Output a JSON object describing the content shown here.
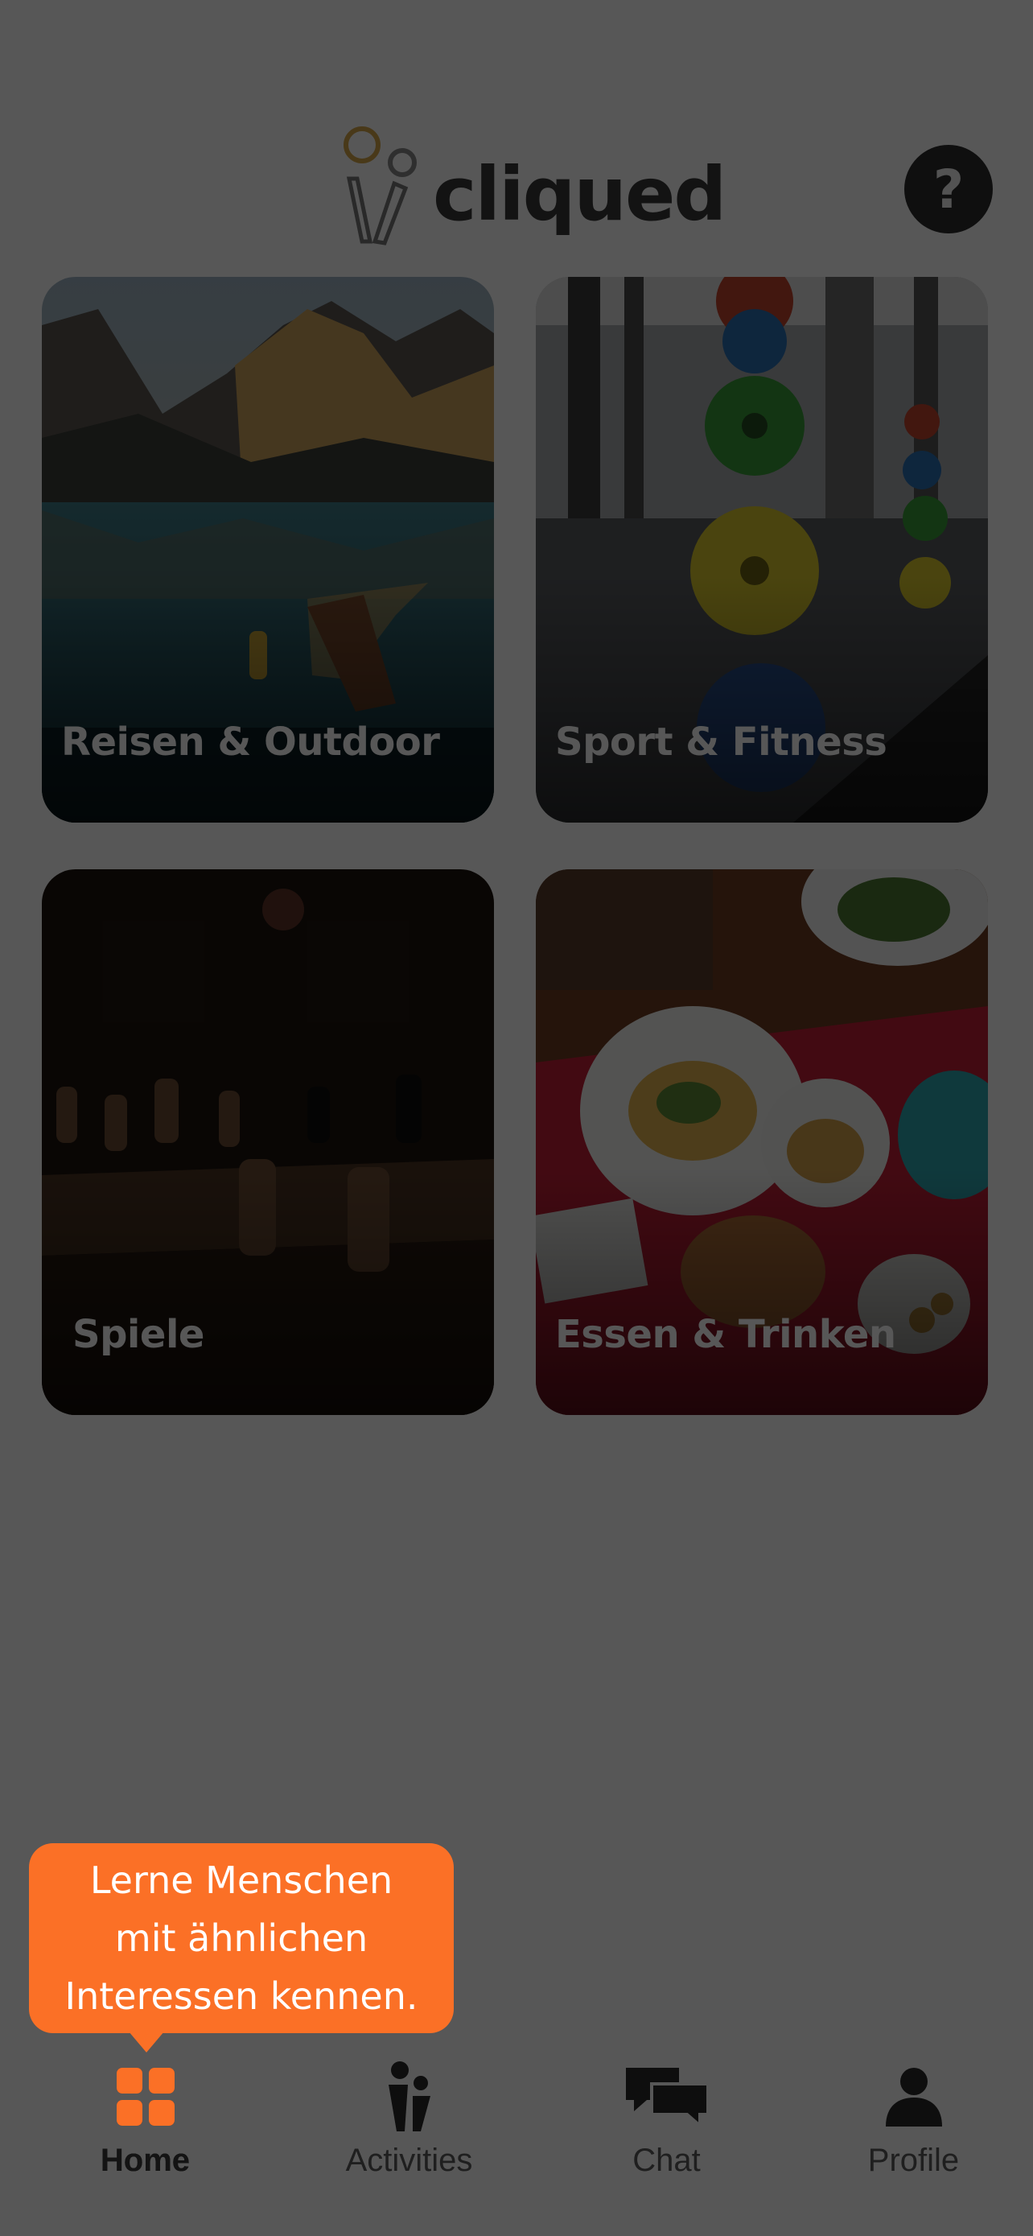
{
  "brand": {
    "name": "cliqued",
    "accent_color": "#fb7026"
  },
  "header": {
    "help_button_label": "?",
    "help_icon": "question-mark-icon"
  },
  "categories": [
    {
      "label": "Reisen & Outdoor",
      "image": "mountain-lake-with-boat"
    },
    {
      "label": "Sport & Fitness",
      "image": "gym-weight-plates"
    },
    {
      "label": "Spiele",
      "image": "chess-board"
    },
    {
      "label": "Essen & Trinken",
      "image": "food-table"
    }
  ],
  "tooltip": {
    "text": "Lerne Menschen mit ähnlichen Interessen kennen.",
    "lines": [
      "Lerne Menschen",
      "mit ähnlichen",
      "Interessen kennen."
    ]
  },
  "tabs": [
    {
      "label": "Home",
      "icon": "grid-icon",
      "active": true
    },
    {
      "label": "Activities",
      "icon": "people-icon",
      "active": false
    },
    {
      "label": "Chat",
      "icon": "chat-bubbles-icon",
      "active": false
    },
    {
      "label": "Profile",
      "icon": "person-icon",
      "active": false
    }
  ]
}
